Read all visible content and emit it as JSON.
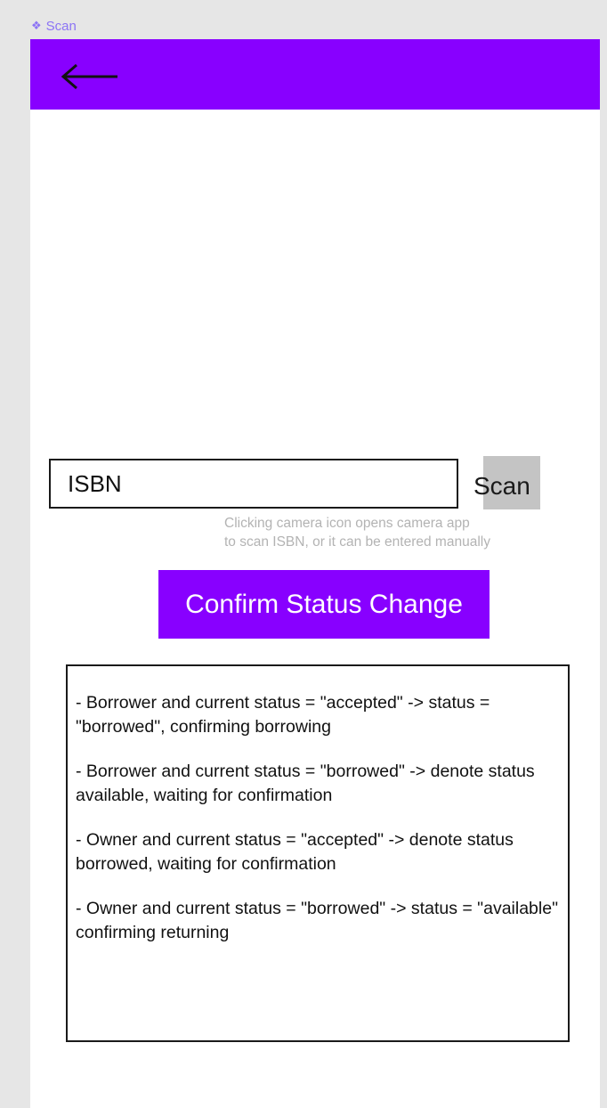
{
  "frame": {
    "label": "Scan",
    "icon": "component-icon"
  },
  "app_bar": {
    "color": "#8800ff",
    "back_icon": "arrow-left-icon"
  },
  "isbn": {
    "placeholder": "ISBN",
    "value": ""
  },
  "scan_button": {
    "label": "Scan",
    "color": "#c4c4c4"
  },
  "hint": {
    "text": "Clicking camera icon opens camera app\nto scan ISBN, or it can be entered manually"
  },
  "confirm_button": {
    "label": "Confirm Status Change",
    "color": "#8800ff"
  },
  "rules": [
    "- Borrower and current status = \"accepted\" -> status = \"borrowed\", confirming borrowing",
    "- Borrower and current status = \"borrowed\" -> denote status available, waiting for confirmation",
    "- Owner and current status = \"accepted\" -> denote status borrowed, waiting for confirmation",
    "- Owner and current status = \"borrowed\" -> status = \"available\" confirming returning"
  ]
}
